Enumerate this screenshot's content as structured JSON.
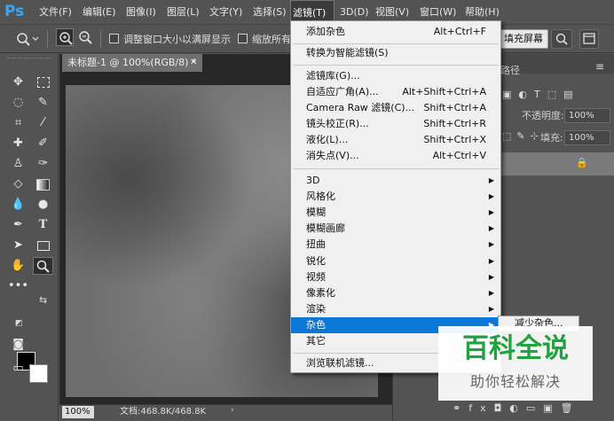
{
  "app": {
    "logo": "Ps"
  },
  "menubar": {
    "items": [
      {
        "label": "文件(F)"
      },
      {
        "label": "编辑(E)"
      },
      {
        "label": "图像(I)"
      },
      {
        "label": "图层(L)"
      },
      {
        "label": "文字(Y)"
      },
      {
        "label": "选择(S)"
      },
      {
        "label": "滤镜(T)",
        "active": true
      },
      {
        "label": "3D(D)"
      },
      {
        "label": "视图(V)"
      },
      {
        "label": "窗口(W)"
      },
      {
        "label": "帮助(H)"
      }
    ]
  },
  "options_bar": {
    "resize_windows_label": "调整窗口大小以满屏显示",
    "zoom_all_label": "缩放所有",
    "fill_screen_label": "填充屏幕"
  },
  "document": {
    "tab_title": "未标题-1 @ 100%(RGB/8) *",
    "zoom_value": "100%",
    "doc_info": "文档:468.8K/468.8K"
  },
  "right_panel": {
    "tab_label": "路径",
    "opacity_label": "不透明度:",
    "opacity_value": "100%",
    "fill_label": "填充:",
    "fill_value": "100%"
  },
  "filter_menu": {
    "group1": [
      {
        "label": "添加杂色",
        "shortcut": "Alt+Ctrl+F"
      }
    ],
    "group2": [
      {
        "label": "转换为智能滤镜(S)",
        "shortcut": ""
      }
    ],
    "group3": [
      {
        "label": "滤镜库(G)...",
        "shortcut": ""
      },
      {
        "label": "自适应广角(A)...",
        "shortcut": "Alt+Shift+Ctrl+A"
      },
      {
        "label": "Camera Raw 滤镜(C)...",
        "shortcut": "Shift+Ctrl+A"
      },
      {
        "label": "镜头校正(R)...",
        "shortcut": "Shift+Ctrl+R"
      },
      {
        "label": "液化(L)...",
        "shortcut": "Shift+Ctrl+X"
      },
      {
        "label": "消失点(V)...",
        "shortcut": "Alt+Ctrl+V"
      }
    ],
    "group4": [
      {
        "label": "3D"
      },
      {
        "label": "风格化"
      },
      {
        "label": "模糊"
      },
      {
        "label": "模糊画廊"
      },
      {
        "label": "扭曲"
      },
      {
        "label": "锐化"
      },
      {
        "label": "视频"
      },
      {
        "label": "像素化"
      },
      {
        "label": "渲染"
      },
      {
        "label": "杂色",
        "highlighted": true
      },
      {
        "label": "其它"
      }
    ],
    "group5": [
      {
        "label": "浏览联机滤镜..."
      }
    ]
  },
  "submenu": {
    "first_item": "减少杂色..."
  },
  "watermark": {
    "title": "百科全说",
    "subtitle": "助你轻松解决"
  },
  "colors": {
    "highlight": "#0a78d7",
    "watermark_green": "#20a33f"
  }
}
